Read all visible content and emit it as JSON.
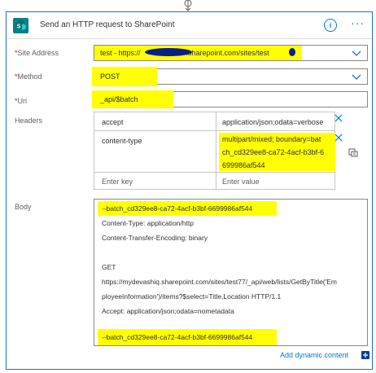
{
  "action": {
    "title": "Send an HTTP request to SharePoint",
    "more_label": "···",
    "info_label": "i"
  },
  "fields": {
    "site_address": {
      "label": "Site Address",
      "required": "*",
      "value": "test - https://",
      "value_suffix": ".sharepoint.com/sites/test"
    },
    "method": {
      "label": "Method",
      "required": "*",
      "value": "POST"
    },
    "uri": {
      "label": "Uri",
      "required": "*",
      "value": "_api/$batch"
    },
    "headers": {
      "label": "Headers",
      "rows": [
        {
          "key": "accept",
          "value": "application/json;odata=verbose"
        },
        {
          "key": "content-type",
          "value_lines": [
            "multipart/mixed; boundary=bat",
            "ch_cd329ee8-ca72-4acf-b3bf-6",
            "699986af544"
          ]
        }
      ],
      "key_placeholder": "Enter key",
      "value_placeholder": "Enter value"
    },
    "body": {
      "label": "Body",
      "lines": [
        "--batch_cd329ee8-ca72-4acf-b3bf-6699986af544",
        "Content-Type: application/http",
        "Content-Transfer-Encoding: binary",
        "",
        "GET",
        "https://mydevashiq.sharepoint.com/sites/test77/_api/web/lists/GetByTitle('Em",
        "ployeeInformation')/items?$select=Title,Location HTTP/1.1",
        "Accept: application/json;odata=nometadata",
        "",
        "",
        "--batch_cd329ee8-ca72-4acf-b3bf-6699986af544"
      ]
    }
  },
  "add_dynamic_content": "Add dynamic content",
  "icons": {
    "sharepoint": "sharepoint-icon",
    "info": "info-icon",
    "more": "more-icon",
    "chevron": "chevron-down-icon",
    "delete": "close-icon",
    "switch": "switch-mode-icon",
    "add": "add-dynamic-content-icon",
    "arrow": "arrow-down-icon"
  },
  "colors": {
    "accent": "#0078d4",
    "highlight": "#ffff00",
    "required": "#a4262c",
    "sharepoint_icon": "#038387"
  }
}
